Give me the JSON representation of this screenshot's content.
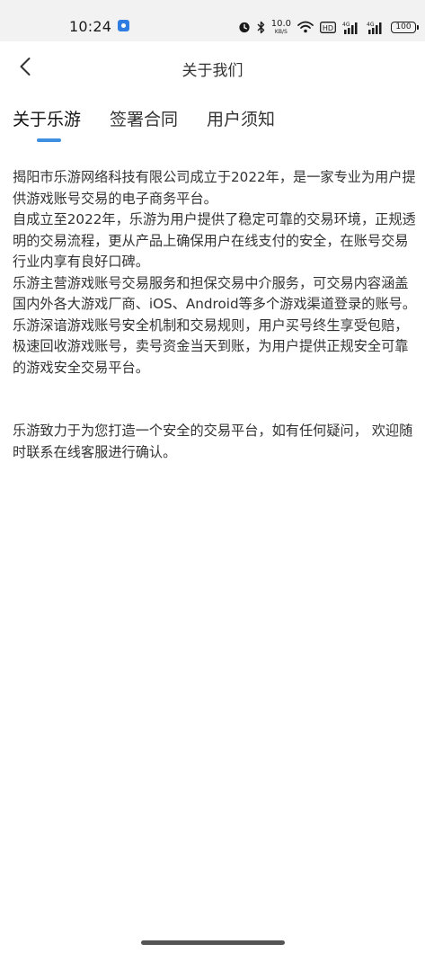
{
  "status_bar": {
    "time": "10:24",
    "net_speed_value": "10.0",
    "net_speed_unit": "KB/S",
    "hd_label": "HD",
    "signal1_label": "4G",
    "signal2_label": "4G",
    "battery_level": "100"
  },
  "header": {
    "title": "关于我们"
  },
  "tabs": [
    {
      "label": "关于乐游"
    },
    {
      "label": "签署合同"
    },
    {
      "label": "用户须知"
    }
  ],
  "content": {
    "paragraphs": [
      "揭阳市乐游网络科技有限公司成立于2022年，是一家专业为用户提供游戏账号交易的电子商务平台。",
      "自成立至2022年，乐游为用户提供了稳定可靠的交易环境，正规透明的交易流程，更从产品上确保用户在线支付的安全，在账号交易行业内享有良好口碑。",
      "乐游主营游戏账号交易服务和担保交易中介服务，可交易内容涵盖国内外各大游戏厂商、iOS、Android等多个游戏渠道登录的账号。",
      "乐游深谙游戏账号安全机制和交易规则，用户买号终生享受包赔，极速回收游戏账号，卖号资金当天到账，为用户提供正规安全可靠的游戏安全交易平台。"
    ],
    "closing": "乐游致力于为您打造一个安全的交易平台，如有任何疑问， 欢迎随时联系在线客服进行确认。"
  }
}
